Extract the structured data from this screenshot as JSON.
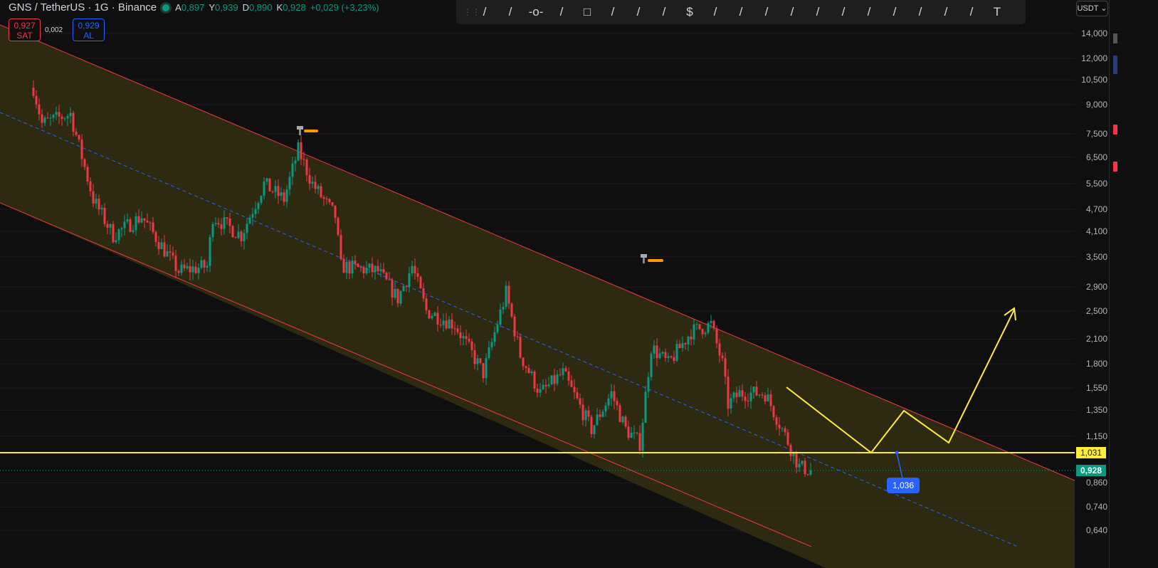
{
  "header": {
    "symbol": "GNS / TetherUS · 1G · Binance",
    "open_label": "A",
    "open": "0,897",
    "high_label": "Y",
    "high": "0,939",
    "low_label": "D",
    "low": "0,890",
    "close_label": "K",
    "close": "0,928",
    "change": "+0,029 (+3,23%)"
  },
  "trade": {
    "sell_price": "0,927",
    "sell_label": "SAT",
    "spread": "0,002",
    "buy_price": "0,929",
    "buy_label": "AL"
  },
  "toolbar": {
    "tools": [
      "parallel-channel-icon",
      "trend-line-icon",
      "horizontal-ray-icon",
      "xabcd-pattern-icon",
      "rectangle-icon",
      "parallelogram-icon",
      "price-range-icon",
      "arc-icon",
      "price-label-icon",
      "fib-retracement-icon",
      "parallel-lines-icon",
      "pitchfork-icon",
      "head-shoulders-icon",
      "elliott-wave-icon",
      "path-icon",
      "bars-pattern-icon",
      "fib-extension-icon",
      "measure-icon",
      "cypher-pattern-icon",
      "ray-icon",
      "text-icon"
    ]
  },
  "axis": {
    "currency": "USDT",
    "ticks": [
      "14,000",
      "12,000",
      "10,500",
      "9,000",
      "7,500",
      "6,500",
      "5,500",
      "4,700",
      "4,100",
      "3,500",
      "2,900",
      "2,500",
      "2,100",
      "1,800",
      "1,550",
      "1,350",
      "1,150",
      "0,860",
      "0,740",
      "0,640"
    ]
  },
  "labels": {
    "horizontal_level": "1,031",
    "last_price": "0,928",
    "marker": "1,036"
  },
  "colors": {
    "up": "#089981",
    "down": "#f23645",
    "channel": "#f23645",
    "level": "#ffeb3b",
    "mid": "#2962ff"
  },
  "chart_data": {
    "type": "candlestick",
    "scale": "log",
    "ylim": [
      0.64,
      14.0
    ],
    "key_path": [
      [
        0,
        10
      ],
      [
        3,
        8
      ],
      [
        13,
        8.5
      ],
      [
        21,
        5
      ],
      [
        28,
        4
      ],
      [
        38,
        4.5
      ],
      [
        51,
        3.2
      ],
      [
        61,
        3.3
      ],
      [
        63,
        4.5
      ],
      [
        73,
        4.0
      ],
      [
        81,
        5.5
      ],
      [
        88,
        5.0
      ],
      [
        93,
        6.8
      ],
      [
        98,
        5.5
      ],
      [
        106,
        4.5
      ],
      [
        108,
        3.3
      ],
      [
        121,
        3.2
      ],
      [
        128,
        2.7
      ],
      [
        133,
        3.3
      ],
      [
        138,
        2.5
      ],
      [
        148,
        2.3
      ],
      [
        158,
        1.7
      ],
      [
        166,
        2.8
      ],
      [
        171,
        1.9
      ],
      [
        178,
        1.5
      ],
      [
        186,
        1.7
      ],
      [
        196,
        1.2
      ],
      [
        203,
        1.5
      ],
      [
        208,
        1.2
      ],
      [
        213,
        1.1
      ],
      [
        217,
        2.0
      ],
      [
        223,
        1.8
      ],
      [
        231,
        2.2
      ],
      [
        238,
        2.3
      ],
      [
        242,
        1.8
      ],
      [
        244,
        1.4
      ],
      [
        248,
        1.5
      ],
      [
        257,
        1.5
      ],
      [
        263,
        1.2
      ],
      [
        269,
        0.95
      ],
      [
        273,
        0.928
      ]
    ],
    "horizontal_level": 1.031,
    "last_price": 0.928
  }
}
